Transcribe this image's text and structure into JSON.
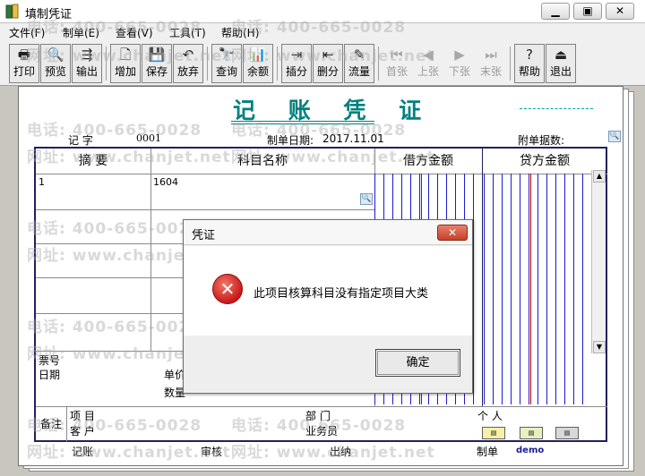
{
  "window": {
    "title": "填制凭证",
    "min_icon": "minimize-icon",
    "max_icon": "maximize-icon",
    "close_icon": "close-icon"
  },
  "menu": [
    {
      "label": "文件(F)"
    },
    {
      "label": "制单(E)"
    },
    {
      "label": "查看(V)"
    },
    {
      "label": "工具(T)"
    },
    {
      "label": "帮助(H)"
    }
  ],
  "toolbar": [
    {
      "label": "打印",
      "icon": "print-icon"
    },
    {
      "label": "预览",
      "icon": "preview-icon"
    },
    {
      "label": "输出",
      "icon": "export-icon"
    },
    {
      "label": "增加",
      "icon": "add-icon"
    },
    {
      "label": "保存",
      "icon": "save-icon"
    },
    {
      "label": "放弃",
      "icon": "undo-icon"
    },
    {
      "label": "查询",
      "icon": "binoculars-icon"
    },
    {
      "label": "余额",
      "icon": "balance-chart-icon"
    },
    {
      "label": "插分",
      "icon": "insert-row-icon"
    },
    {
      "label": "删分",
      "icon": "delete-row-icon"
    },
    {
      "label": "流量",
      "icon": "cashflow-icon"
    },
    {
      "label": "首张",
      "icon": "first-icon"
    },
    {
      "label": "上张",
      "icon": "prev-icon"
    },
    {
      "label": "下张",
      "icon": "next-icon"
    },
    {
      "label": "末张",
      "icon": "last-icon"
    },
    {
      "label": "帮助",
      "icon": "help-icon"
    },
    {
      "label": "退出",
      "icon": "exit-icon"
    }
  ],
  "voucher": {
    "title": "记 账 凭 证",
    "word_label": "记    字",
    "number": "0001",
    "date_label": "制单日期:",
    "date": "2017.11.01",
    "attachments_label": "附单据数:",
    "headers": {
      "summary": "摘  要",
      "account": "科目名称",
      "debit": "借方金额",
      "credit": "贷方金额"
    },
    "rows": [
      {
        "summary": "1",
        "account": "1604"
      }
    ],
    "ticket_label": "票号",
    "date_row_label": "日期",
    "unit_price_label": "单价",
    "quantity_label": "数量",
    "remark_label": "备注",
    "project_label": "项    目",
    "customer_label": "客    户",
    "dept_label": "部    门",
    "person_label": "个    人",
    "salesman_label": "业务员"
  },
  "footer": {
    "bookkeeper": "记账",
    "auditor": "审核",
    "cashier": "出纳",
    "maker": "制单",
    "maker_name": "demo"
  },
  "watermark": {
    "phone": "电话: 400-665-0028",
    "site": "网址: www.chanjet.net"
  },
  "dialog": {
    "title": "凭证",
    "close_label": "✕",
    "message": "此项目核算科目没有指定项目大类",
    "ok_label": "确定"
  }
}
